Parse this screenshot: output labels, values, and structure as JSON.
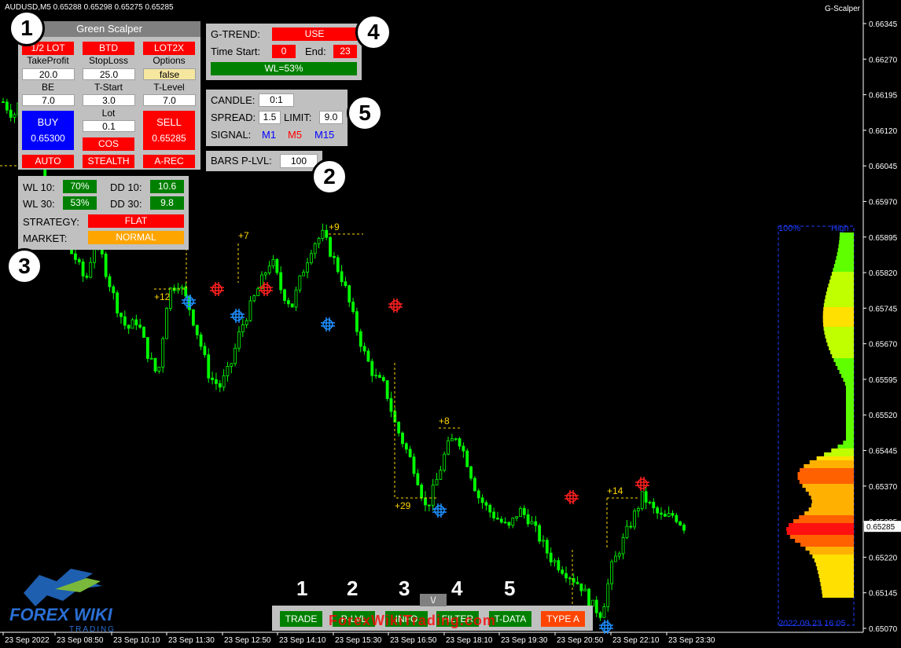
{
  "window": {
    "title": "AUDUSD,M5  0.65288 0.65298 0.65275 0.65285",
    "indicator_name": "G-Scalper"
  },
  "panel1": {
    "title": "Green Scalper",
    "btn_half_lot": "1/2 LOT",
    "btn_btd": "BTD",
    "btn_lot2x": "LOT2X",
    "lbl_takeprofit": "TakeProfit",
    "lbl_stoploss": "StopLoss",
    "lbl_options": "Options",
    "takeprofit": "20.0",
    "stoploss": "25.0",
    "options": "false",
    "lbl_be": "BE",
    "lbl_tstart": "T-Start",
    "lbl_tlevel": "T-Level",
    "be": "7.0",
    "tstart": "3.0",
    "tlevel": "7.0",
    "lbl_lot": "Lot",
    "lot": "0.1",
    "buy_label": "BUY",
    "buy_price": "0.65300",
    "sell_label": "SELL",
    "sell_price": "0.65285",
    "btn_cos": "COS",
    "btn_auto": "AUTO",
    "btn_stealth": "STEALTH",
    "btn_arec": "A-REC"
  },
  "panel3": {
    "lbl_wl10": "WL 10:",
    "wl10": "70%",
    "lbl_dd10": "DD 10:",
    "dd10": "10.6",
    "lbl_wl30": "WL 30:",
    "wl30": "53%",
    "lbl_dd30": "DD 30:",
    "dd30": "9.8",
    "lbl_strategy": "STRATEGY:",
    "strategy": "FLAT",
    "lbl_market": "MARKET:",
    "market": "NORMAL"
  },
  "panel4": {
    "lbl_gtrend": "G-TREND:",
    "gtrend": "USE",
    "lbl_timestart": "Time Start:",
    "timestart": "0",
    "lbl_end": "End:",
    "end": "23",
    "wl": "WL=53%"
  },
  "panel5": {
    "lbl_candle": "CANDLE:",
    "candle": "0:1",
    "lbl_spread": "SPREAD:",
    "spread": "1.5",
    "lbl_limit": "LIMIT:",
    "limit": "9.0",
    "lbl_signal": "SIGNAL:",
    "sig_m1": "M1",
    "sig_m5": "M5",
    "sig_m15": "M15"
  },
  "panel2": {
    "lbl_bars": "BARS P-LVL:",
    "bars": "100"
  },
  "callouts": [
    "1",
    "2",
    "3",
    "4",
    "5"
  ],
  "bottom_tabs": [
    {
      "label": "TRADE",
      "num": "1"
    },
    {
      "label": "P-LVL",
      "num": "2"
    },
    {
      "label": "INFO",
      "num": "3"
    },
    {
      "label": "FILTER",
      "num": "4"
    },
    {
      "label": "T-DATA",
      "num": "5"
    },
    {
      "label": "TYPE A",
      "num": ""
    }
  ],
  "collapse_label": "\\/",
  "watermark": "ForexWikiTrading.com",
  "logo": {
    "text": "FOREX WIKI",
    "sub": "TRADING"
  },
  "colors": {
    "bull": "#00ff00",
    "bg": "#000000",
    "panel": "#c0c0c0",
    "level": "#ffd700",
    "buy_marker": "#1e90ff",
    "sell_marker": "#ff2020"
  },
  "chart_data": {
    "type": "candlestick",
    "y_ticks": [
      "0.66345",
      "0.66270",
      "0.66195",
      "0.66120",
      "0.66045",
      "0.65970",
      "0.65895",
      "0.65820",
      "0.65745",
      "0.65670",
      "0.65595",
      "0.65520",
      "0.65445",
      "0.65370",
      "0.65295",
      "0.65220",
      "0.65145",
      "0.65070"
    ],
    "current_price": "0.65285",
    "x_ticks": [
      "23 Sep 2022",
      "23 Sep 08:50",
      "23 Sep 10:10",
      "23 Sep 11:30",
      "23 Sep 12:50",
      "23 Sep 14:10",
      "23 Sep 15:30",
      "23 Sep 16:50",
      "23 Sep 18:10",
      "23 Sep 19:30",
      "23 Sep 20:50",
      "23 Sep 22:10",
      "23 Sep 23:30"
    ],
    "level_labels": [
      "+7",
      "+12",
      "+9",
      "+8",
      "+29",
      "+14"
    ],
    "profile_labels": {
      "left": "100%",
      "right": "High",
      "date": "2022.09.23 16:05"
    },
    "close_path": [
      0.6618,
      0.6615,
      0.662,
      0.6612,
      0.66,
      0.6592,
      0.6588,
      0.6585,
      0.658,
      0.659,
      0.6582,
      0.6575,
      0.657,
      0.6572,
      0.6565,
      0.656,
      0.6578,
      0.658,
      0.6575,
      0.6568,
      0.656,
      0.6558,
      0.6562,
      0.657,
      0.6575,
      0.658,
      0.6585,
      0.6578,
      0.6575,
      0.6582,
      0.6588,
      0.659,
      0.6585,
      0.658,
      0.6572,
      0.6565,
      0.656,
      0.6558,
      0.655,
      0.6545,
      0.654,
      0.6532,
      0.6538,
      0.6545,
      0.6548,
      0.6542,
      0.6535,
      0.6532,
      0.653,
      0.6528,
      0.6532,
      0.653,
      0.6526,
      0.6522,
      0.652,
      0.6518,
      0.6516,
      0.6512,
      0.651,
      0.652,
      0.6525,
      0.653,
      0.6535,
      0.6532,
      0.653,
      0.6531,
      0.65285
    ]
  }
}
